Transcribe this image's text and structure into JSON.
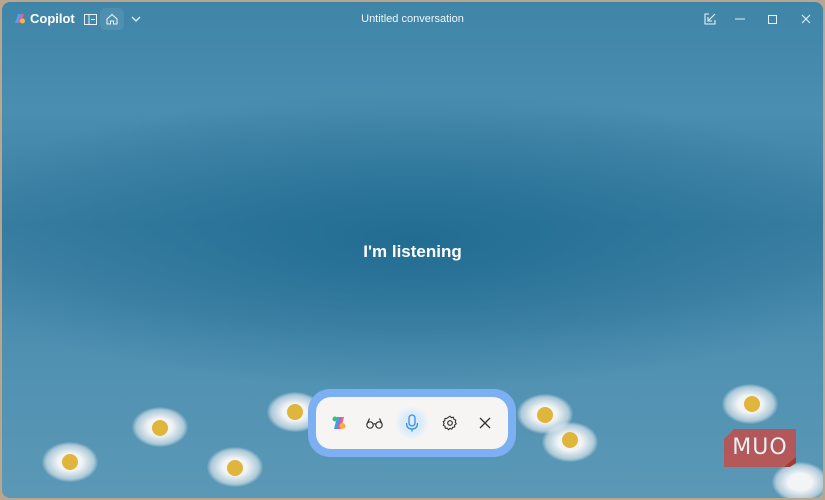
{
  "app": {
    "name": "Copilot",
    "window_title": "Untitled conversation"
  },
  "main": {
    "status_text": "I'm listening"
  },
  "voice_bar": {
    "buttons": [
      "copilot",
      "vision",
      "microphone",
      "settings",
      "close"
    ]
  },
  "watermark": {
    "text": "MUO"
  },
  "colors": {
    "bar_border": "#7cb0f2",
    "mic_active": "#3a8fd8",
    "watermark": "#c0504d"
  }
}
